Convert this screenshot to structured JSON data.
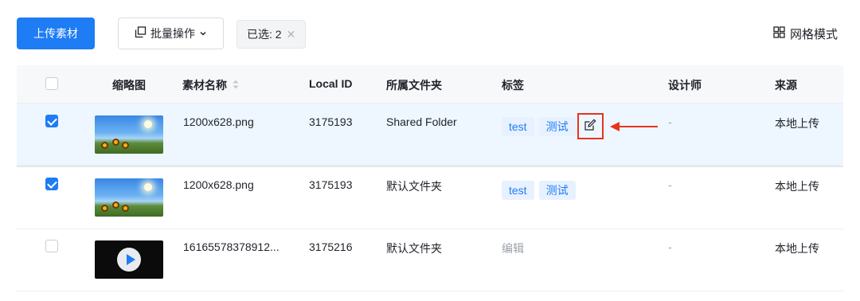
{
  "toolbar": {
    "upload_label": "上传素材",
    "batch_label": "批量操作",
    "selected_label": "已选: 2",
    "clear_glyph": "✕",
    "grid_label": "网格模式"
  },
  "table": {
    "headers": {
      "thumbnail": "缩略图",
      "name": "素材名称",
      "local_id": "Local ID",
      "folder": "所属文件夹",
      "tags": "标签",
      "designer": "设计师",
      "source": "来源"
    },
    "rows": [
      {
        "checked": true,
        "thumb": "image",
        "name": "1200x628.png",
        "local_id": "3175193",
        "folder": "Shared Folder",
        "tags": [
          "test",
          "测试"
        ],
        "designer": "-",
        "source": "本地上传"
      },
      {
        "checked": true,
        "thumb": "image",
        "name": "1200x628.png",
        "local_id": "3175193",
        "folder": "默认文件夹",
        "tags": [
          "test",
          "测试"
        ],
        "designer": "-",
        "source": "本地上传"
      },
      {
        "checked": false,
        "thumb": "video",
        "name": "16165578378912...",
        "local_id": "3175216",
        "folder": "默认文件夹",
        "edit_label": "编辑",
        "designer": "-",
        "source": "本地上传"
      }
    ]
  },
  "colors": {
    "primary": "#1e7cf5",
    "annotation": "#e8331c",
    "selected_row": "#eef6ff"
  },
  "icons": {
    "batch": "copy-icon",
    "dropdown": "chevron-down-icon",
    "grid": "grid-icon",
    "sort": "sort-icon",
    "edit": "edit-icon",
    "play": "play-icon"
  }
}
